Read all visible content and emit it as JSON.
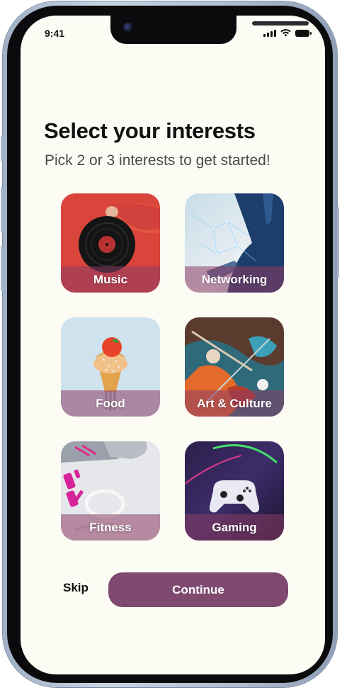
{
  "status_bar": {
    "time": "9:41"
  },
  "header": {
    "title": "Select your interests",
    "subtitle": "Pick 2 or 3 interests to get started!"
  },
  "interests": [
    {
      "label": "Music",
      "icon": "vinyl-record-icon"
    },
    {
      "label": "Networking",
      "icon": "business-network-icon"
    },
    {
      "label": "Food",
      "icon": "ice-cream-cone-icon"
    },
    {
      "label": "Art & Culture",
      "icon": "paint-palette-icon"
    },
    {
      "label": "Fitness",
      "icon": "dumbbell-sneakers-icon"
    },
    {
      "label": "Gaming",
      "icon": "game-controller-icon"
    }
  ],
  "actions": {
    "skip_label": "Skip",
    "continue_label": "Continue"
  },
  "colors": {
    "background": "#fcfcf5",
    "accent": "#7f4970",
    "label_overlay": "#8c3c64"
  }
}
